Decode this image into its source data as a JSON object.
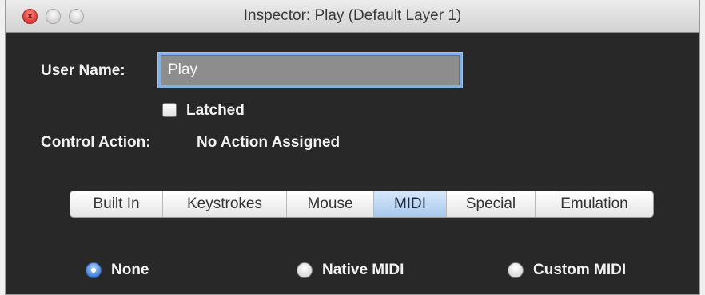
{
  "window": {
    "title": "Inspector: Play (Default Layer 1)"
  },
  "fields": {
    "user_name_label": "User Name:",
    "user_name_value": "Play",
    "latched_label": "Latched",
    "control_action_label": "Control Action:",
    "control_action_value": "No Action Assigned"
  },
  "tabs": [
    {
      "label": "Built In",
      "selected": false
    },
    {
      "label": "Keystrokes",
      "selected": false
    },
    {
      "label": "Mouse",
      "selected": false
    },
    {
      "label": "MIDI",
      "selected": true
    },
    {
      "label": "Special",
      "selected": false
    },
    {
      "label": "Emulation",
      "selected": false
    }
  ],
  "midi_options": [
    {
      "label": "None",
      "selected": true
    },
    {
      "label": "Native MIDI",
      "selected": false
    },
    {
      "label": "Custom MIDI",
      "selected": false
    }
  ],
  "colors": {
    "panel_background": "#282828",
    "selected_tab": "#a9c9ee",
    "focus_ring": "#7fb0e8",
    "radio_selected": "#3b7bd8",
    "close_button": "#d8382f"
  },
  "icons": [
    "close-icon",
    "checkbox-icon",
    "radio-icon"
  ]
}
